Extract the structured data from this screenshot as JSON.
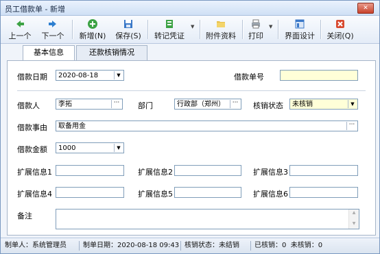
{
  "window": {
    "title": "员工借款单 - 新增"
  },
  "toolbar": {
    "buttons": [
      {
        "label": "上一个",
        "icon": "arrow-left-icon"
      },
      {
        "label": "下一个",
        "icon": "arrow-right-icon"
      },
      {
        "label": "新增(N)",
        "icon": "add-icon"
      },
      {
        "label": "保存(S)",
        "icon": "save-icon"
      },
      {
        "label": "转记凭证",
        "icon": "voucher-icon"
      },
      {
        "label": "附件资料",
        "icon": "attachment-icon"
      },
      {
        "label": "打印",
        "icon": "printer-icon"
      },
      {
        "label": "界面设计",
        "icon": "layout-design-icon"
      },
      {
        "label": "关闭(Q)",
        "icon": "close-icon"
      }
    ]
  },
  "tabs": [
    {
      "label": "基本信息",
      "active": true
    },
    {
      "label": "还款核销情况",
      "active": false
    }
  ],
  "form": {
    "loan_date_label": "借款日期",
    "loan_date_value": "2020-08-18",
    "loan_no_label": "借款单号",
    "loan_no_value": "",
    "borrower_label": "借款人",
    "borrower_value": "李拓",
    "dept_label": "部门",
    "dept_value": "行政部（郑州）",
    "verify_status_label": "核销状态",
    "verify_status_value": "未核销",
    "reason_label": "借款事由",
    "reason_value": "取备用金",
    "amount_label": "借款金额",
    "amount_value": "1000",
    "ext1_label": "扩展信息1",
    "ext2_label": "扩展信息2",
    "ext3_label": "扩展信息3",
    "ext4_label": "扩展信息4",
    "ext5_label": "扩展信息5",
    "ext6_label": "扩展信息6",
    "memo_label": "备注"
  },
  "status": {
    "creator": "制单人：系统管理员",
    "created": "制单日期：2020-08-18 09:43",
    "verify": "核销状态：未结销",
    "counts": "已核销：0  未核销：0"
  },
  "colors": {
    "accent_yellow": "#ffffd8",
    "titlebar": "#cfe0f5",
    "close": "#c8432c"
  }
}
